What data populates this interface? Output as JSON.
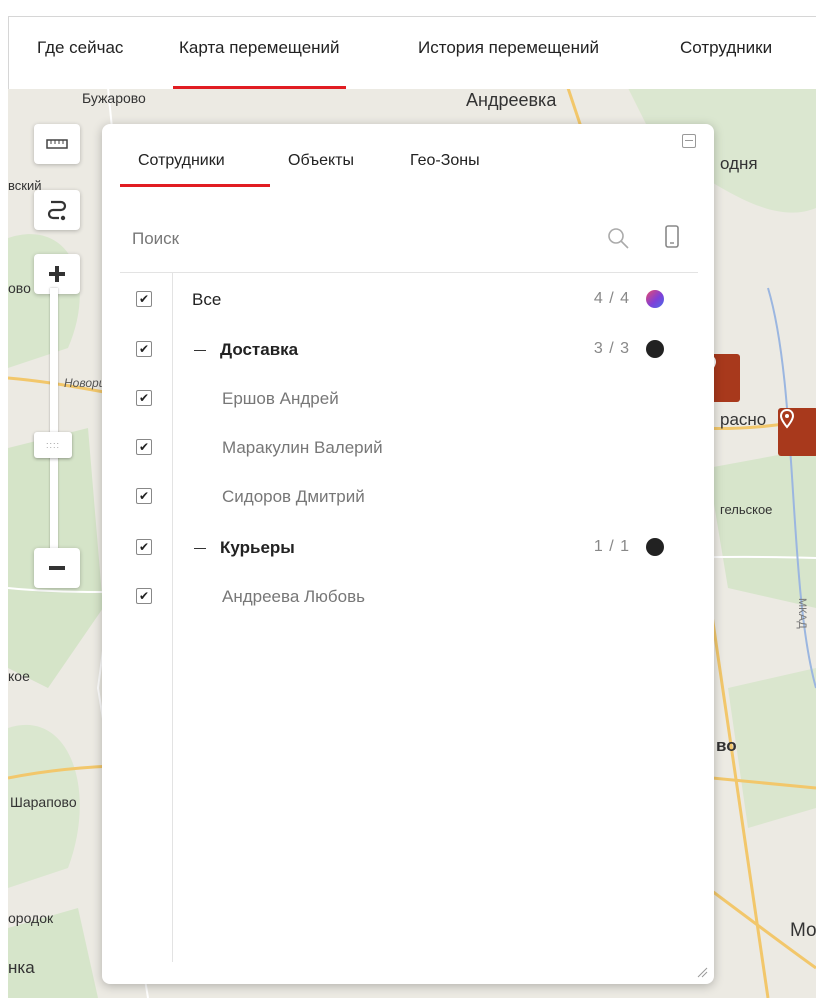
{
  "nav": {
    "tabs": [
      {
        "label": "Где сейчас",
        "active": false
      },
      {
        "label": "Карта перемещений",
        "active": true
      },
      {
        "label": "История перемещений",
        "active": false
      },
      {
        "label": "Сотрудники",
        "active": false
      }
    ],
    "accent": "#e11d22"
  },
  "map": {
    "labels": [
      "Бужарово",
      "Андреевка",
      "одня",
      "вский",
      "ово",
      "Новори",
      "расно",
      "гельское",
      "МКАД",
      "кое",
      "во",
      "Шарапово",
      "ородок",
      "нка",
      "Мо"
    ],
    "pin_color": "#a8391c"
  },
  "tools": {
    "ruler": "ruler-icon",
    "route": "route-icon",
    "zoom_in": "plus-icon",
    "zoom_out": "minus-icon"
  },
  "panel": {
    "tabs": [
      {
        "label": "Сотрудники",
        "active": true
      },
      {
        "label": "Объекты",
        "active": false
      },
      {
        "label": "Гео-Зоны",
        "active": false
      }
    ],
    "search": {
      "placeholder": "Поиск",
      "value": ""
    },
    "list": [
      {
        "type": "all",
        "label": "Все",
        "count": "4 / 4",
        "checked": true,
        "dot": "gradient"
      },
      {
        "type": "group",
        "label": "Доставка",
        "count": "3 / 3",
        "checked": true,
        "dot": "#222222"
      },
      {
        "type": "member",
        "label": "Ершов Андрей",
        "checked": true
      },
      {
        "type": "member",
        "label": "Маракулин Валерий",
        "checked": true
      },
      {
        "type": "member",
        "label": "Сидоров Дмитрий",
        "checked": true
      },
      {
        "type": "group",
        "label": "Курьеры",
        "count": "1 / 1",
        "checked": true,
        "dot": "#222222"
      },
      {
        "type": "member",
        "label": "Андреева Любовь",
        "checked": true
      }
    ]
  }
}
